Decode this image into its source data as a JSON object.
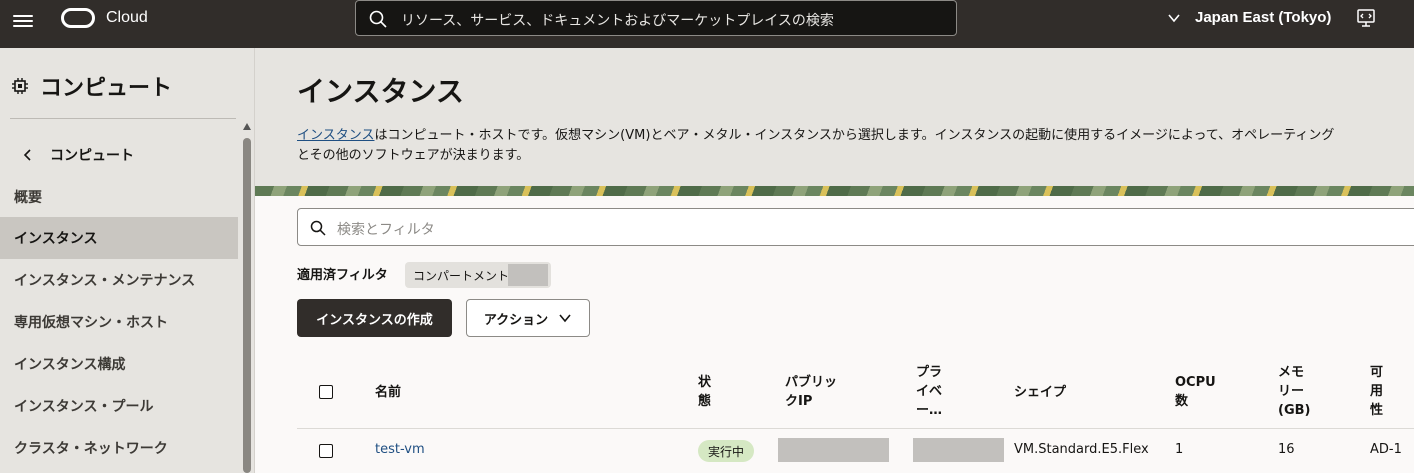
{
  "topbar": {
    "brand": "Cloud",
    "search_placeholder": "リソース、サービス、ドキュメントおよびマーケットプレイスの検索",
    "region": "Japan East (Tokyo)"
  },
  "sidebar": {
    "title": "コンピュート",
    "back_label": "コンピュート",
    "items": [
      {
        "label": "概要"
      },
      {
        "label": "インスタンス"
      },
      {
        "label": "インスタンス・メンテナンス"
      },
      {
        "label": "専用仮想マシン・ホスト"
      },
      {
        "label": "インスタンス構成"
      },
      {
        "label": "インスタンス・プール"
      },
      {
        "label": "クラスタ・ネットワーク"
      }
    ]
  },
  "main": {
    "title": "インスタンス",
    "desc_link": "インスタンス",
    "desc_line1_rest": "はコンピュート・ホストです。仮想マシン(VM)とベア・メタル・インスタンスから選択します。インスタンスの起動に使用するイメージによって、オペレーティング",
    "desc_line2": "とその他のソフトウェアが決まります。",
    "filter_placeholder": "検索とフィルタ",
    "applied_filters_label": "適用済フィルタ",
    "chip_label": "コンパートメント",
    "create_button": "インスタンスの作成",
    "actions_button": "アクション",
    "columns": {
      "name": "名前",
      "state_1": "状",
      "state_2": "態",
      "public_ip_1": "パブリッ",
      "public_ip_2": "クIP",
      "private_1": "プラ",
      "private_2": "イベ",
      "private_3": "ー…",
      "shape": "シェイプ",
      "ocpu_1": "OCPU",
      "ocpu_2": "数",
      "memory_1": "メモ",
      "memory_2": "リー",
      "memory_3": "(GB)",
      "avail_1": "可",
      "avail_2": "用",
      "avail_3": "性"
    },
    "rows": [
      {
        "name": "test-vm",
        "state": "実行中",
        "shape": "VM.Standard.E5.Flex",
        "ocpu": "1",
        "memory": "16",
        "ad": "AD-1"
      }
    ]
  }
}
